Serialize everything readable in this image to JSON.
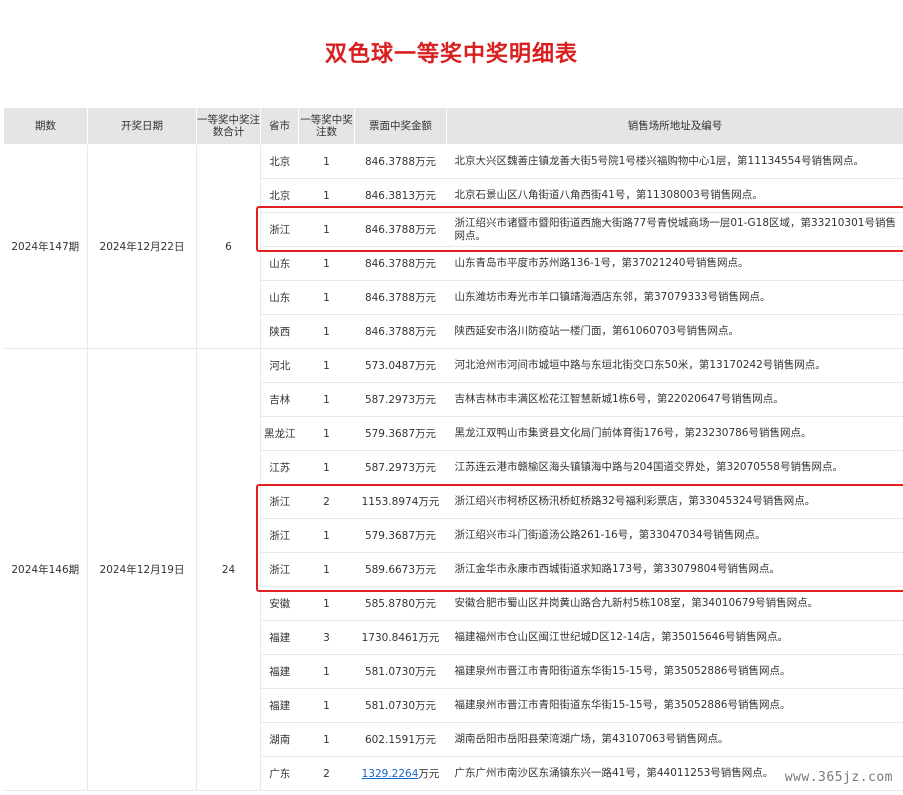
{
  "title": "双色球一等奖中奖明细表",
  "watermark": "www.365jz.com",
  "headers": {
    "issue": "期数",
    "date": "开奖日期",
    "total": "一等奖中奖注数合计",
    "province": "省市",
    "count": "一等奖中奖注数",
    "amount": "票面中奖金额",
    "address": "销售场所地址及编号"
  },
  "groups": [
    {
      "issue": "2024年147期",
      "date": "2024年12月22日",
      "total": "6",
      "rows": [
        {
          "province": "北京",
          "count": "1",
          "amount": "846.3788万元",
          "address": "北京大兴区魏善庄镇龙善大街5号院1号楼兴福购物中心1层，第11134554号销售网点。"
        },
        {
          "province": "北京",
          "count": "1",
          "amount": "846.3813万元",
          "address": "北京石景山区八角街道八角西街41号，第11308003号销售网点。"
        },
        {
          "province": "浙江",
          "count": "1",
          "amount": "846.3788万元",
          "address": "浙江绍兴市诸暨市暨阳街道西施大街路77号青悦城商场一层01-G18区域，第33210301号销售网点。"
        },
        {
          "province": "山东",
          "count": "1",
          "amount": "846.3788万元",
          "address": "山东青岛市平度市苏州路136-1号，第37021240号销售网点。"
        },
        {
          "province": "山东",
          "count": "1",
          "amount": "846.3788万元",
          "address": "山东潍坊市寿光市羊口镇靖海酒店东邻，第37079333号销售网点。"
        },
        {
          "province": "陕西",
          "count": "1",
          "amount": "846.3788万元",
          "address": "陕西延安市洛川防疫站一楼门面，第61060703号销售网点。"
        }
      ]
    },
    {
      "issue": "2024年146期",
      "date": "2024年12月19日",
      "total": "24",
      "rows": [
        {
          "province": "河北",
          "count": "1",
          "amount": "573.0487万元",
          "address": "河北沧州市河间市城垣中路与东垣北街交口东50米，第13170242号销售网点。"
        },
        {
          "province": "吉林",
          "count": "1",
          "amount": "587.2973万元",
          "address": "吉林吉林市丰满区松花江智慧新城1栋6号，第22020647号销售网点。"
        },
        {
          "province": "黑龙江",
          "count": "1",
          "amount": "579.3687万元",
          "address": "黑龙江双鸭山市集贤县文化局门前体育街176号，第23230786号销售网点。"
        },
        {
          "province": "江苏",
          "count": "1",
          "amount": "587.2973万元",
          "address": "江苏连云港市赣榆区海头镇镇海中路与204国道交界处，第32070558号销售网点。"
        },
        {
          "province": "浙江",
          "count": "2",
          "amount": "1153.8974万元",
          "address": "浙江绍兴市柯桥区杨汛桥虹桥路32号福利彩票店，第33045324号销售网点。"
        },
        {
          "province": "浙江",
          "count": "1",
          "amount": "579.3687万元",
          "address": "浙江绍兴市斗门街道汤公路261-16号，第33047034号销售网点。"
        },
        {
          "province": "浙江",
          "count": "1",
          "amount": "589.6673万元",
          "address": "浙江金华市永康市西城街道求知路173号，第33079804号销售网点。"
        },
        {
          "province": "安徽",
          "count": "1",
          "amount": "585.8780万元",
          "address": "安徽合肥市蜀山区井岗黄山路合九新村5栋108室，第34010679号销售网点。"
        },
        {
          "province": "福建",
          "count": "3",
          "amount": "1730.8461万元",
          "address": "福建福州市仓山区闽江世纪城D区12-14店，第35015646号销售网点。"
        },
        {
          "province": "福建",
          "count": "1",
          "amount": "581.0730万元",
          "address": "福建泉州市晋江市青阳街道东华街15-15号，第35052886号销售网点。"
        },
        {
          "province": "福建",
          "count": "1",
          "amount": "581.0730万元",
          "address": "福建泉州市晋江市青阳街道东华街15-15号，第35052886号销售网点。"
        },
        {
          "province": "湖南",
          "count": "1",
          "amount": "602.1591万元",
          "address": "湖南岳阳市岳阳县荣湾湖广场，第43107063号销售网点。"
        },
        {
          "province": "广东",
          "count": "2",
          "amount_link": "1329.2264",
          "amount_unit": "万元",
          "address": "广东广州市南沙区东涌镇东兴一路41号，第44011253号销售网点。"
        }
      ]
    }
  ]
}
